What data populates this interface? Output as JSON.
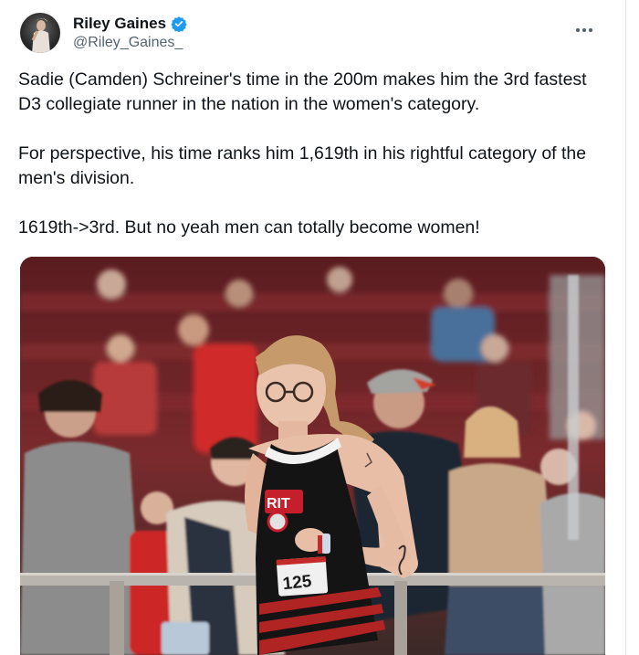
{
  "post": {
    "author": {
      "display_name": "Riley Gaines",
      "handle": "@Riley_Gaines_",
      "verified": true
    },
    "paragraphs": [
      "Sadie (Camden) Schreiner's time in the 200m makes him the 3rd fastest D3 collegiate runner in the nation in the women's category.",
      "For perspective, his time ranks him 1,619th in his rightful category of the men's division.",
      "1619th->3rd. But no yeah men can totally become women!"
    ],
    "media": {
      "bib_number": "125",
      "jersey_letters": "RIT"
    }
  },
  "icons": {
    "verified": "verified-badge-icon",
    "more": "more-options-icon"
  },
  "colors": {
    "verified_blue": "#1d9bf0",
    "text_primary": "#0f1419",
    "text_secondary": "#536471",
    "stadium_red": "#7a1f24"
  }
}
